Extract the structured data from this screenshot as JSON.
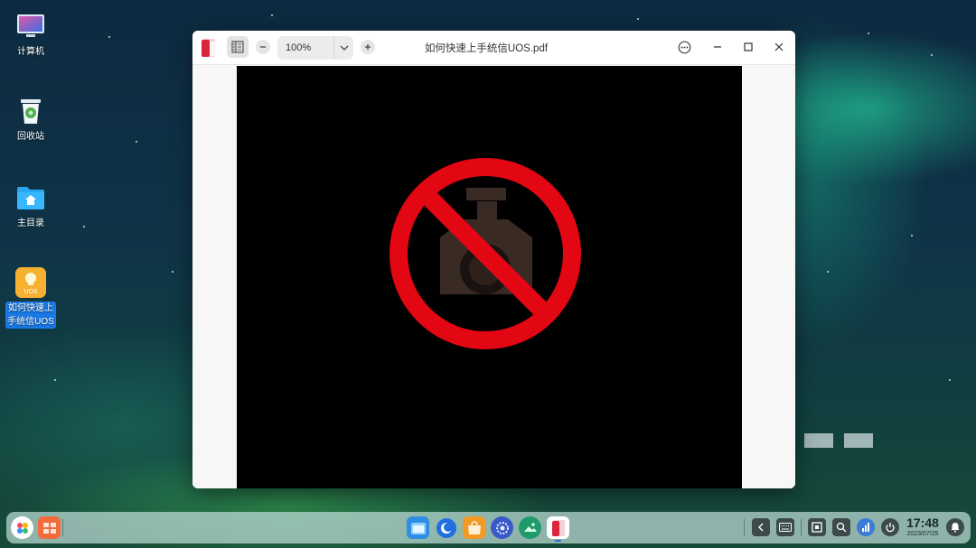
{
  "desktop": {
    "icons": [
      {
        "label": "计算机"
      },
      {
        "label": "回收站"
      },
      {
        "label": "主目录"
      },
      {
        "label": "如何快速上手统信UOS",
        "badge": "UOS"
      }
    ]
  },
  "window": {
    "title": "如何快速上手统信UOS.pdf",
    "zoom": "100%"
  },
  "taskbar": {
    "time": "17:48",
    "date": "2023/07/25"
  },
  "colors": {
    "dock_bg": "#bedcd7",
    "selection": "#1a79e6",
    "prohibit_red": "#e30613"
  },
  "icons": {
    "app": "document-viewer-icon",
    "thumbnails": "thumbnails-icon",
    "zoom_out": "minus-icon",
    "zoom_in": "plus-icon",
    "dropdown": "chevron-down-icon",
    "menu": "more-icon",
    "minimize": "minimize-icon",
    "maximize": "maximize-icon",
    "close": "close-icon",
    "page_image": "no-camera-icon"
  }
}
